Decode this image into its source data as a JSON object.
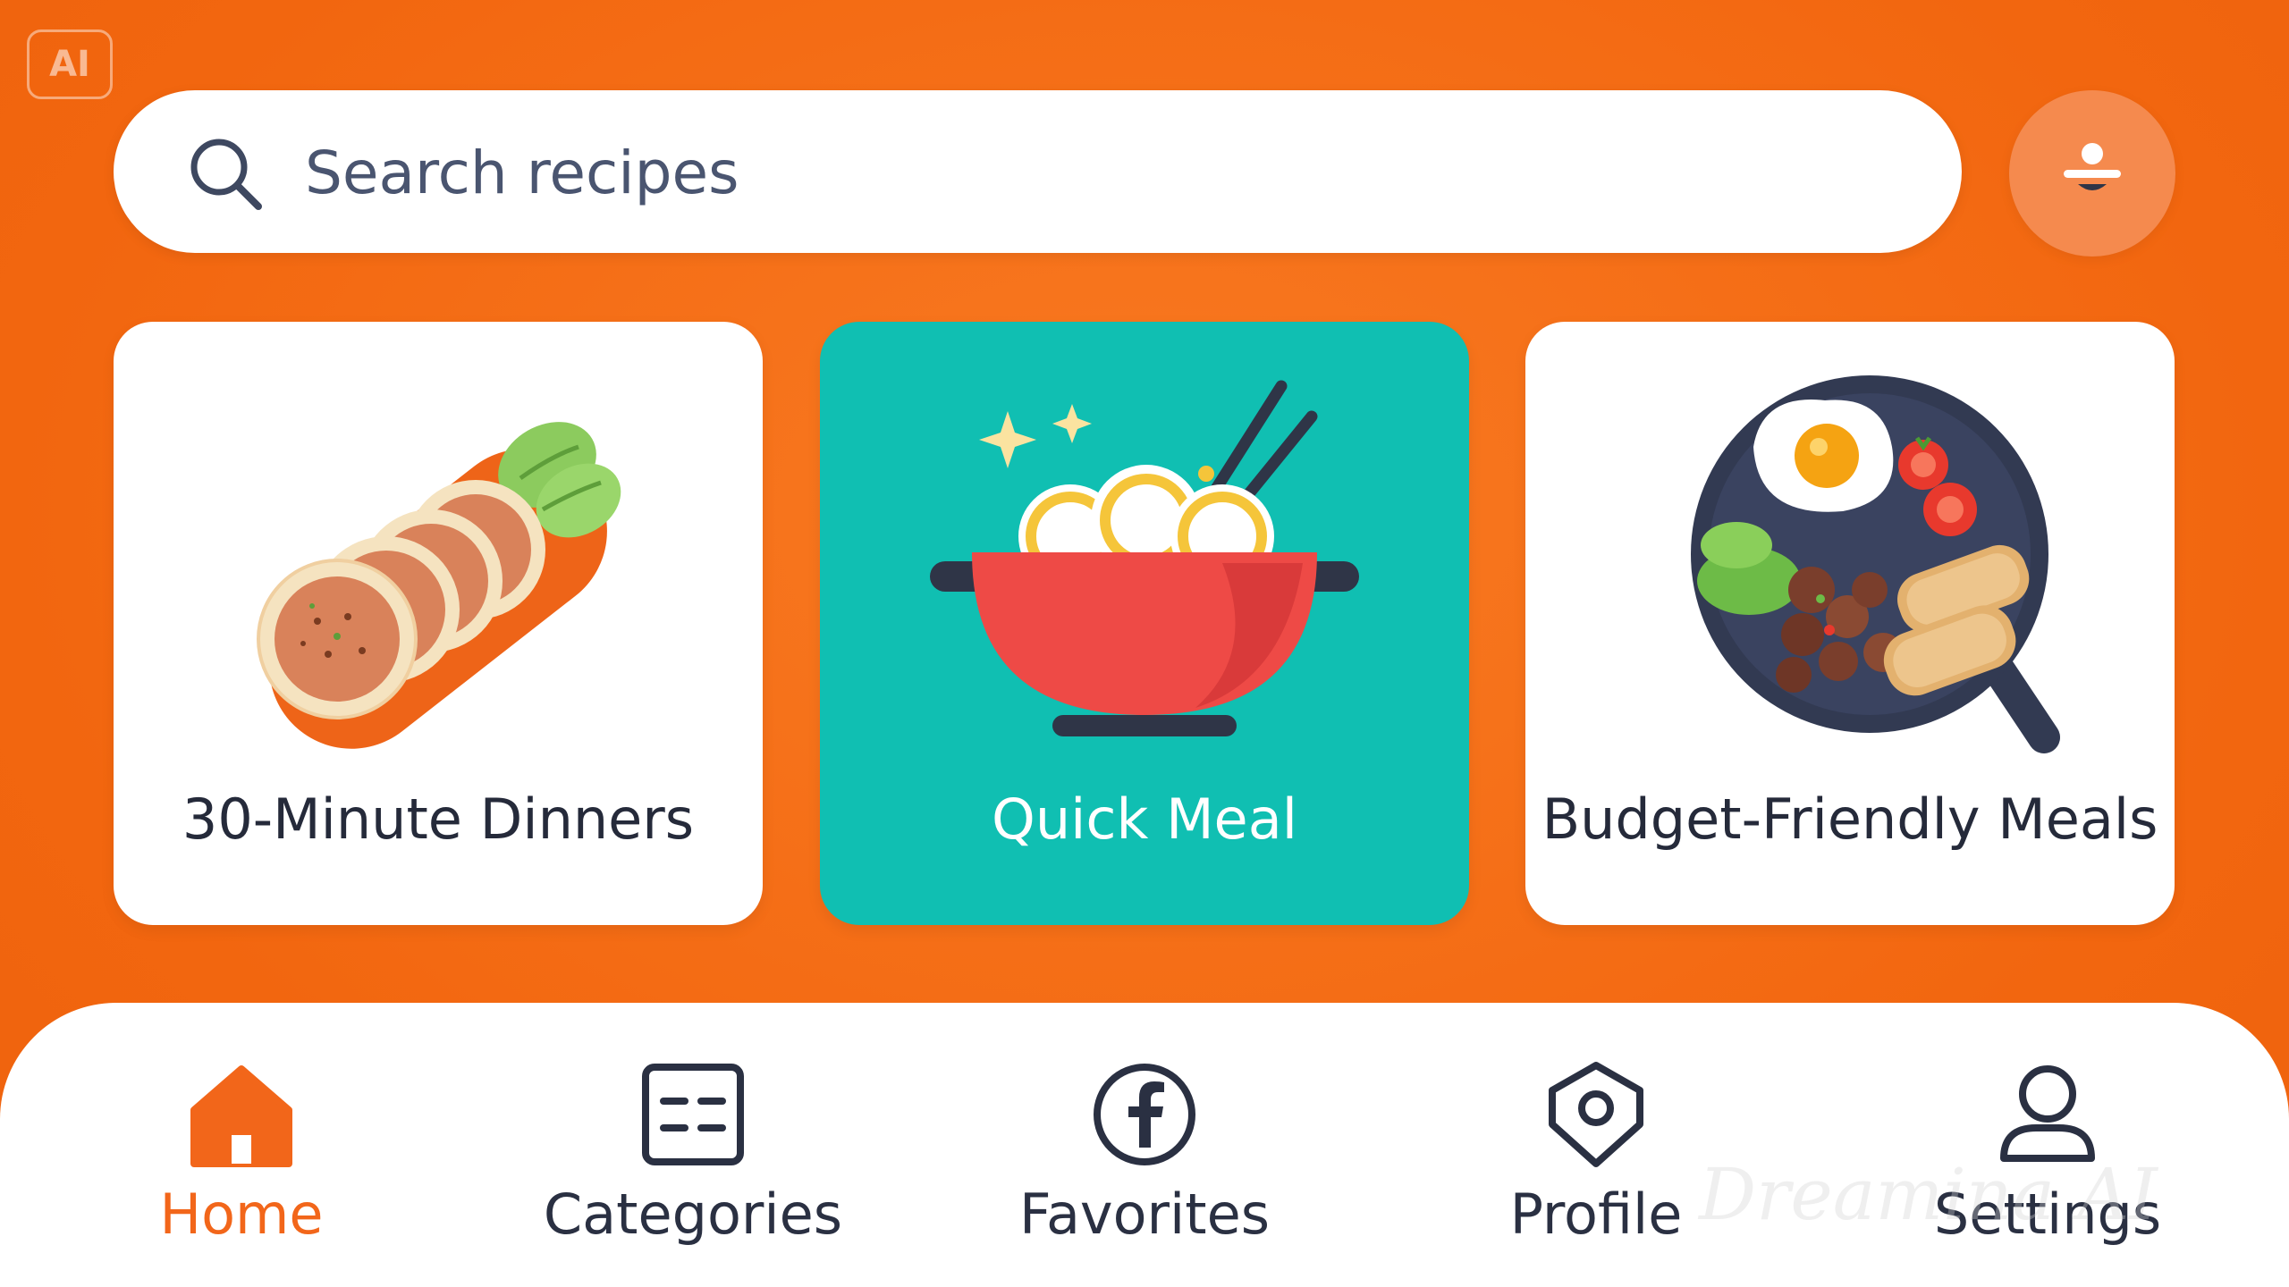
{
  "badge": {
    "text": "AI"
  },
  "search": {
    "placeholder": "Search recipes",
    "value": ""
  },
  "profile_button": {
    "icon": "person-icon"
  },
  "cards": [
    {
      "label": "30-Minute Dinners",
      "icon": "patties-plate-illustration",
      "selected": false
    },
    {
      "label": "Quick Meal",
      "icon": "noodle-bowl-illustration",
      "selected": true
    },
    {
      "label": "Budget-Friendly Meals",
      "icon": "breakfast-skillet-illustration",
      "selected": false
    }
  ],
  "nav": {
    "items": [
      {
        "label": "Home",
        "icon": "home-icon",
        "active": true
      },
      {
        "label": "Categories",
        "icon": "categories-icon",
        "active": false
      },
      {
        "label": "Favorites",
        "icon": "facebook-icon",
        "active": false
      },
      {
        "label": "Profile",
        "icon": "tag-icon",
        "active": false
      },
      {
        "label": "Settings",
        "icon": "user-icon",
        "active": false
      }
    ]
  },
  "watermark": {
    "text": "Dreamina AI"
  },
  "colors": {
    "background": "#F66D1A",
    "accent": "#F2661A",
    "selected_card": "#10BFB2",
    "card": "#FFFFFF",
    "text_dark": "#252A3A",
    "profile_button": "#F58A4E"
  }
}
